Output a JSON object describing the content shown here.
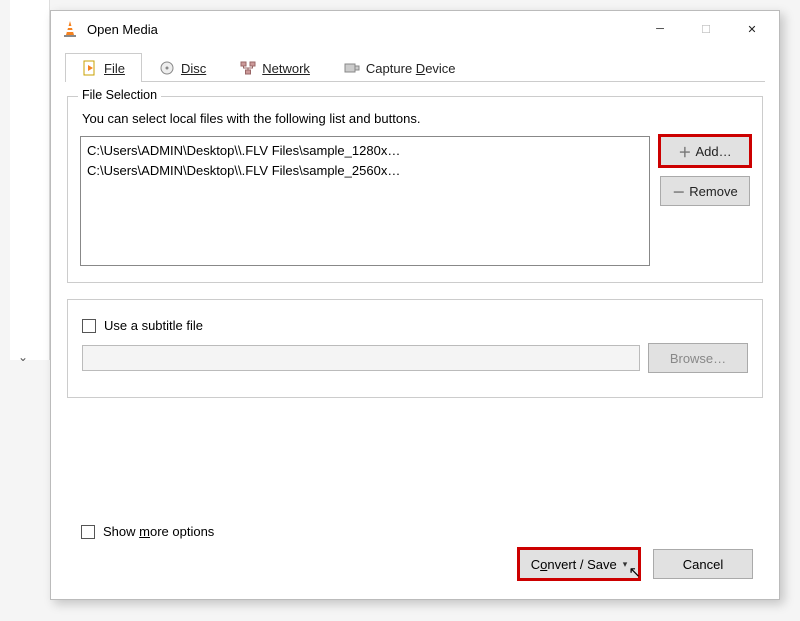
{
  "window": {
    "title": "Open Media"
  },
  "tabs": {
    "file": "File",
    "disc": "Disc",
    "network": "Network",
    "capture": "Capture Device"
  },
  "file_section": {
    "legend": "File Selection",
    "hint": "You can select local files with the following list and buttons.",
    "files": [
      {
        "prefix": "C:\\Users\\ADMIN\\Desktop\\",
        "blurred": "                       ",
        "suffix": "\\.FLV Files\\sample_1280x…"
      },
      {
        "prefix": "C:\\Users\\ADMIN\\Desktop\\",
        "blurred": "                       ",
        "suffix": "\\.FLV Files\\sample_2560x…"
      }
    ],
    "add_label": "Add…",
    "remove_label": "Remove"
  },
  "subtitle": {
    "checkbox_label": "Use a subtitle file",
    "browse_label": "Browse…"
  },
  "show_more": {
    "label_pre": "Show ",
    "label_u": "m",
    "label_post": "ore options"
  },
  "footer": {
    "convert_pre": "C",
    "convert_u": "o",
    "convert_post": "nvert / Save",
    "cancel": "Cancel"
  }
}
